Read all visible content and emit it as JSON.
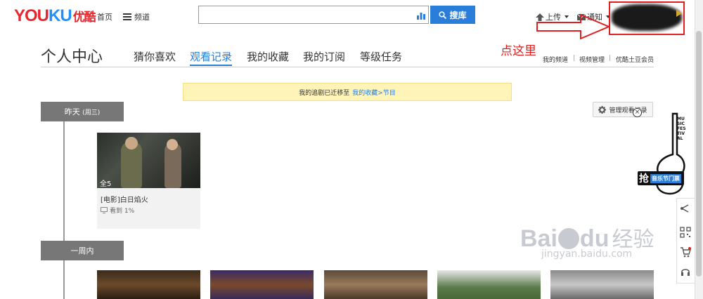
{
  "header": {
    "logo_latin_a": "YOU",
    "logo_latin_b": "KU",
    "logo_cn": "优酷",
    "nav_home": "首页",
    "nav_channel": "频道",
    "search_placeholder": "",
    "search_button": "搜库",
    "upload": "上传",
    "notify": "通知"
  },
  "annotation": {
    "click_here": "点这里"
  },
  "page": {
    "title": "个人中心",
    "tabs": [
      "猜你喜欢",
      "观看记录",
      "我的收藏",
      "我的订阅",
      "等级任务"
    ],
    "active_tab": 1,
    "links": [
      "我的频道",
      "视频管理",
      "优酷土豆会员"
    ]
  },
  "notice": {
    "text": "我的追剧已迁移至",
    "link": "我的收藏>节目"
  },
  "history": {
    "manage_button": "管理观看记录",
    "groups": [
      {
        "label": "昨天",
        "sub": "(周三)",
        "items": [
          {
            "episodes": "全5",
            "title": "[电影]白日焰火",
            "progress": "看到 1%"
          }
        ]
      },
      {
        "label": "一周内",
        "sub": ""
      }
    ]
  },
  "promo": {
    "vertical_text": "MUSIC FESTIVAL",
    "badge_char": "抢",
    "badge_text": "音乐节门票"
  },
  "watermark": {
    "main": "Bai",
    "du": "du",
    "cn": "经验",
    "url": "jingyan.baidu.com"
  },
  "colors": {
    "accent": "#2a7dd9",
    "youku_red": "#e8262d",
    "annotation_red": "#e02020",
    "notice_bg": "#fff4b8"
  }
}
